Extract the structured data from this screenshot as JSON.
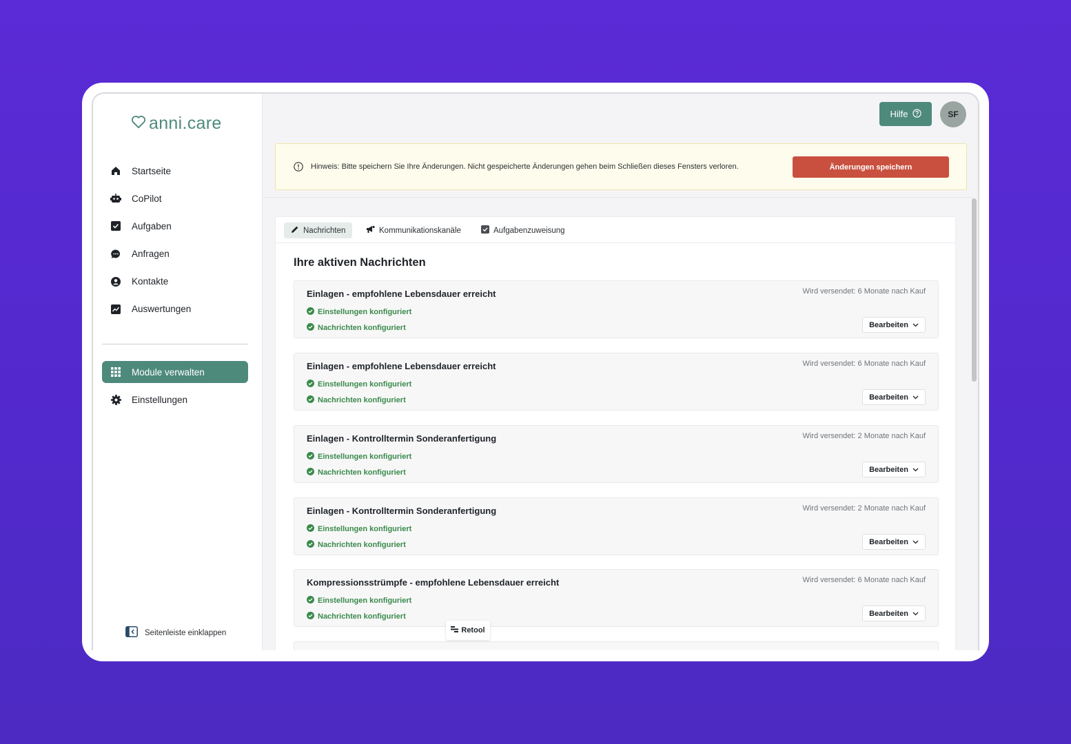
{
  "brand": {
    "name": "anni.care",
    "color": "#4e8a7c"
  },
  "sidebar": {
    "items": [
      {
        "label": "Startseite",
        "icon": "home-icon"
      },
      {
        "label": "CoPilot",
        "icon": "robot-icon"
      },
      {
        "label": "Aufgaben",
        "icon": "checkbox-icon"
      },
      {
        "label": "Anfragen",
        "icon": "chat-icon"
      },
      {
        "label": "Kontakte",
        "icon": "user-circle-icon"
      },
      {
        "label": "Auswertungen",
        "icon": "chart-icon"
      }
    ],
    "secondary": [
      {
        "label": "Module verwalten",
        "icon": "grid-icon",
        "active": true
      },
      {
        "label": "Einstellungen",
        "icon": "gear-icon"
      }
    ],
    "collapse_label": "Seitenleiste einklappen"
  },
  "header": {
    "help_label": "Hilfe",
    "avatar_initials": "SF"
  },
  "notice": {
    "text": "Hinweis: Bitte speichern Sie Ihre Änderungen. Nicht gespeicherte Änderungen gehen beim Schließen dieses Fensters verloren.",
    "save_label": "Änderungen speichern",
    "save_color": "#c9503f"
  },
  "tabs": [
    {
      "label": "Nachrichten",
      "icon": "pencil-icon",
      "active": true
    },
    {
      "label": "Kommunikationskanäle",
      "icon": "megaphone-icon"
    },
    {
      "label": "Aufgabenzuweisung",
      "icon": "checkbox-icon"
    }
  ],
  "section_title": "Ihre aktiven Nachrichten",
  "messages": [
    {
      "title": "Einlagen - empfohlene Lebensdauer erreicht",
      "sent": "Wird versendet: 6 Monate nach Kauf",
      "status1": "Einstellungen konfiguriert",
      "status2": "Nachrichten konfiguriert",
      "edit_label": "Bearbeiten"
    },
    {
      "title": "Einlagen - empfohlene Lebensdauer erreicht",
      "sent": "Wird versendet: 6 Monate nach Kauf",
      "status1": "Einstellungen konfiguriert",
      "status2": "Nachrichten konfiguriert",
      "edit_label": "Bearbeiten"
    },
    {
      "title": "Einlagen - Kontrolltermin Sonderanfertigung",
      "sent": "Wird versendet: 2 Monate nach Kauf",
      "status1": "Einstellungen konfiguriert",
      "status2": "Nachrichten konfiguriert",
      "edit_label": "Bearbeiten"
    },
    {
      "title": "Einlagen - Kontrolltermin Sonderanfertigung",
      "sent": "Wird versendet: 2 Monate nach Kauf",
      "status1": "Einstellungen konfiguriert",
      "status2": "Nachrichten konfiguriert",
      "edit_label": "Bearbeiten"
    },
    {
      "title": "Kompressionsstrümpfe - empfohlene Lebensdauer erreicht",
      "sent": "Wird versendet: 6 Monate nach Kauf",
      "status1": "Einstellungen konfiguriert",
      "status2": "Nachrichten konfiguriert",
      "edit_label": "Bearbeiten"
    }
  ],
  "retool_label": "Retool",
  "status_color": "#3a8a4a"
}
